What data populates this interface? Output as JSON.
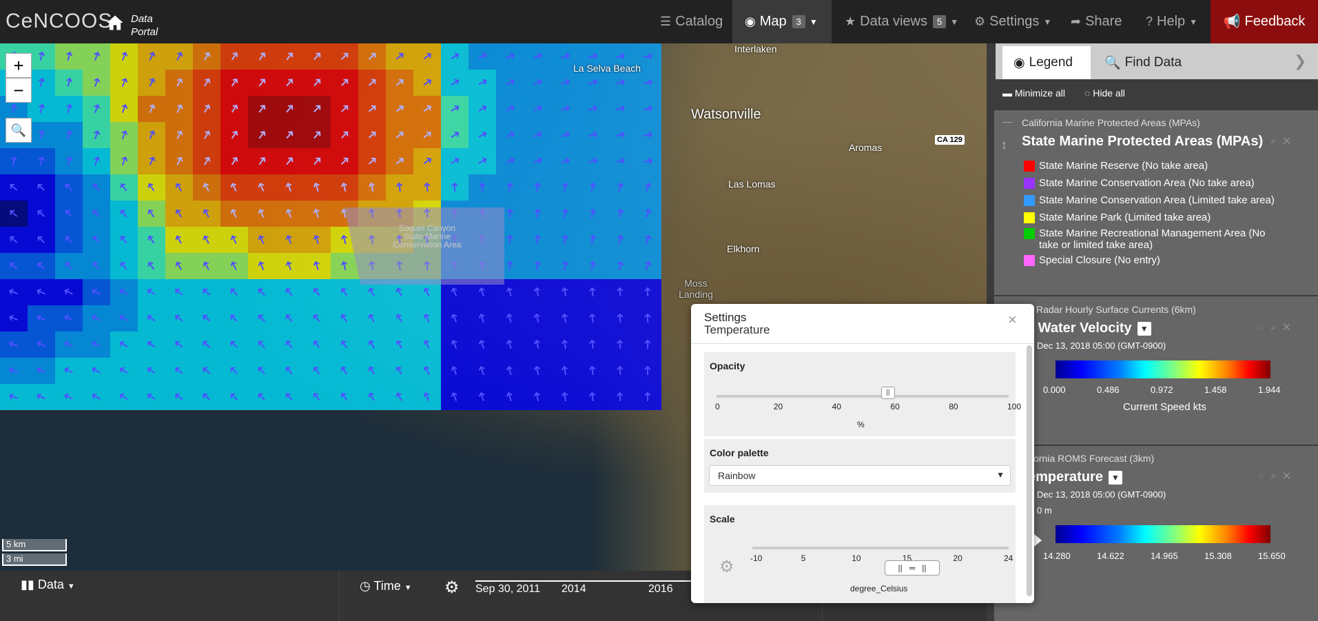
{
  "header": {
    "logo": "CeNCOOS",
    "portal_line1": "Data",
    "portal_line2": "Portal",
    "nav": {
      "catalog": "Catalog",
      "map": "Map",
      "map_badge": "3",
      "data_views": "Data views",
      "data_views_badge": "5",
      "settings": "Settings",
      "share": "Share",
      "help": "Help",
      "feedback": "Feedback"
    }
  },
  "map": {
    "places": {
      "la_selva": "La Selva Beach",
      "watsonville": "Watsonville",
      "aromas": "Aromas",
      "las_lomas": "Las Lomas",
      "elkhorn": "Elkhorn",
      "moss_landing": "Moss Landing",
      "interlaken": "Interlaken",
      "highway": "CA 129"
    },
    "mpa_label": "Soquel Canyon State Marine Conservation Area",
    "zoom_in": "+",
    "zoom_out": "−",
    "scale_km": "5 km",
    "scale_mi": "3 mi"
  },
  "bottom": {
    "data": "Data",
    "time": "Time",
    "timeline_start": "Sep 30, 2011",
    "timeline_2014": "2014",
    "timeline_2016": "2016"
  },
  "panel": {
    "tab_legend": "Legend",
    "tab_find": "Find Data",
    "minimize_all": "Minimize all",
    "hide_all": "Hide all",
    "layers": [
      {
        "category": "California Marine Protected Areas (MPAs)",
        "title": "State Marine Protected Areas (MPAs)",
        "items": [
          {
            "label": "State Marine Reserve (No take area)",
            "color": "#ff0000"
          },
          {
            "label": "State Marine Conservation Area (No take area)",
            "color": "#9933ff"
          },
          {
            "label": "State Marine Conservation Area (Limited take area)",
            "color": "#3399ff"
          },
          {
            "label": "State Marine Park (Limited take area)",
            "color": "#ffff00"
          },
          {
            "label": "State Marine Recreational Management Area (No take or limited take area)",
            "color": "#00cc00"
          },
          {
            "label": "Special Closure (No entry)",
            "color": "#ff66ff"
          }
        ]
      },
      {
        "category": "Radar Hourly Surface Currents (6km)",
        "title": "a Water Velocity",
        "date": "Dec 13, 2018 05:00 (GMT-0900)",
        "ticks": [
          "0.000",
          "0.486",
          "0.972",
          "1.458",
          "1.944"
        ],
        "colorbar_title": "Current Speed kts"
      },
      {
        "category": "lifornia ROMS Forecast (3km)",
        "title": "emperature",
        "date": "Dec 13, 2018 05:00 (GMT-0900)",
        "depth": "0 m",
        "ticks": [
          "14.280",
          "14.622",
          "14.965",
          "15.308",
          "15.650"
        ]
      }
    ]
  },
  "settings_dialog": {
    "title": "Settings",
    "subtitle": "Temperature",
    "opacity_label": "Opacity",
    "opacity_value": 58,
    "opacity_ticks": [
      "0",
      "20",
      "40",
      "60",
      "80",
      "100"
    ],
    "opacity_unit": "%",
    "palette_label": "Color palette",
    "palette_value": "Rainbow",
    "scale_label": "Scale",
    "scale_ticks": [
      "-10",
      "5",
      "10",
      "15",
      "20",
      "24"
    ],
    "scale_unit": "degree_Celsius"
  }
}
